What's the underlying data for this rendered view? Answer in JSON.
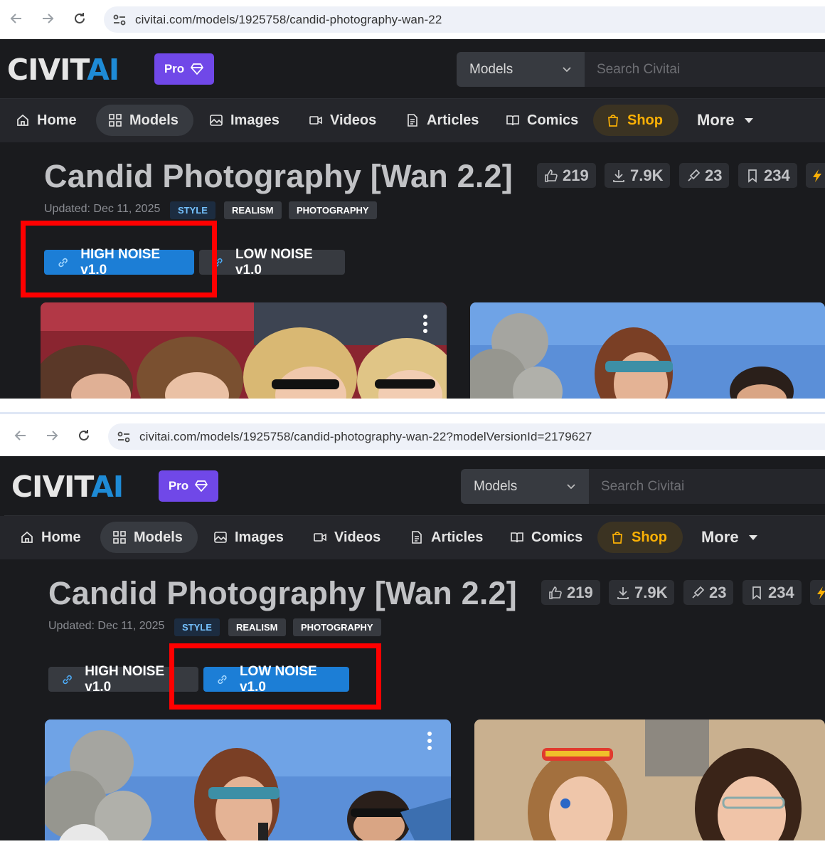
{
  "screens": [
    {
      "url": "civitai.com/models/1925758/candid-photography-wan-22",
      "highlight": "HIGH NOISE v1.0"
    },
    {
      "url": "civitai.com/models/1925758/candid-photography-wan-22?modelVersionId=2179627",
      "highlight": "LOW NOISE v1.0"
    }
  ],
  "header": {
    "logo_left": "CIVIT",
    "logo_right": "AI",
    "pro_label": "Pro",
    "search_scope": "Models",
    "search_placeholder": "Search Civitai"
  },
  "nav": [
    "Home",
    "Models",
    "Images",
    "Videos",
    "Articles",
    "Comics",
    "Shop",
    "More"
  ],
  "model": {
    "title": "Candid Photography [Wan 2.2]",
    "stats": {
      "likes": "219",
      "downloads": "7.9K",
      "generations": "23",
      "bookmarks": "234"
    },
    "updated": "Updated: Dec 11, 2025",
    "tags": [
      "STYLE",
      "REALISM",
      "PHOTOGRAPHY"
    ],
    "versions": [
      "HIGH NOISE v1.0",
      "LOW NOISE v1.0"
    ]
  },
  "colors": {
    "accent": "#1c7ed6",
    "pro": "#7048e8",
    "shop": "#fab005",
    "highlight_box": "#ff0000"
  }
}
